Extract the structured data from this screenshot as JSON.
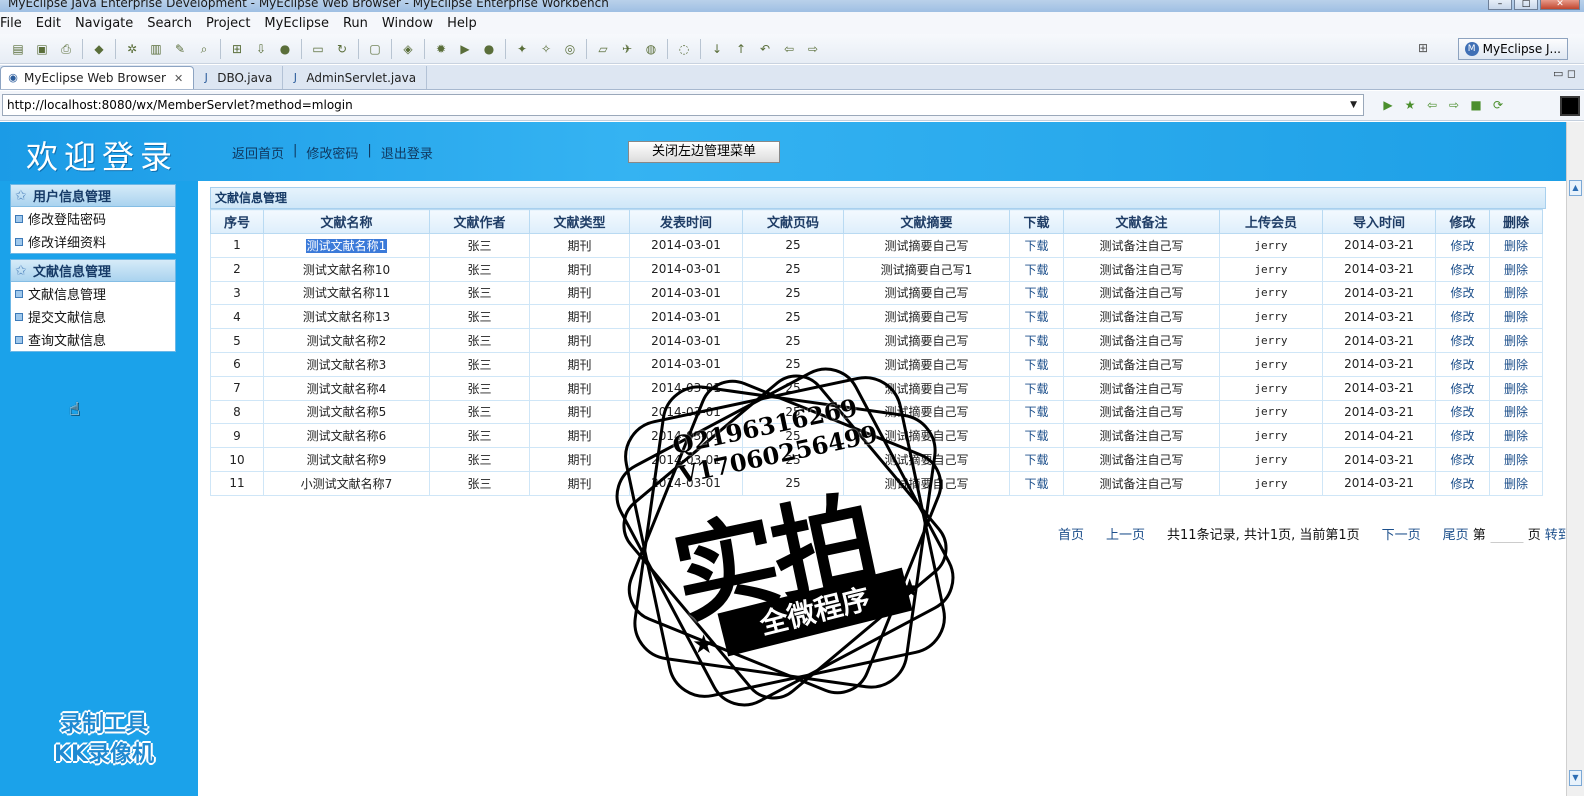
{
  "window": {
    "title": "MyEclipse Java Enterprise Development - MyEclipse Web Browser - MyEclipse Enterprise Workbench"
  },
  "menu": [
    "File",
    "Edit",
    "Navigate",
    "Search",
    "Project",
    "MyEclipse",
    "Run",
    "Window",
    "Help"
  ],
  "perspective": {
    "label": "MyEclipse J..."
  },
  "tabs": [
    {
      "label": "MyEclipse Web Browser",
      "active": true
    },
    {
      "label": "DBO.java",
      "active": false
    },
    {
      "label": "AdminServlet.java",
      "active": false
    }
  ],
  "address": {
    "url": "http://localhost:8080/wx/MemberServlet?method=mlogin"
  },
  "banner": {
    "welcome": "欢迎登录",
    "links": [
      "返回首页",
      "修改密码",
      "退出登录"
    ],
    "separator": "|",
    "close_menu_button": "关闭左边管理菜单"
  },
  "sidebar": {
    "sections": [
      {
        "title": "用户信息管理",
        "items": [
          "修改登陆密码",
          "修改详细资料"
        ]
      },
      {
        "title": "文献信息管理",
        "items": [
          "文献信息管理",
          "提交文献信息",
          "查询文献信息"
        ]
      }
    ],
    "kk_watermark": [
      "录制工具",
      "KK录像机"
    ]
  },
  "content": {
    "title": "文献信息管理",
    "columns": [
      "序号",
      "文献名称",
      "文献作者",
      "文献类型",
      "发表时间",
      "文献页码",
      "文献摘要",
      "下载",
      "文献备注",
      "上传会员",
      "导入时间",
      "修改",
      "删除"
    ],
    "rows": [
      [
        "1",
        "测试文献名称1",
        "张三",
        "期刊",
        "2014-03-01",
        "25",
        "测试摘要自己写",
        "下载",
        "测试备注自己写",
        "jerry",
        "2014-03-21",
        "修改",
        "删除"
      ],
      [
        "2",
        "测试文献名称10",
        "张三",
        "期刊",
        "2014-03-01",
        "25",
        "测试摘要自己写1",
        "下载",
        "测试备注自己写",
        "jerry",
        "2014-03-21",
        "修改",
        "删除"
      ],
      [
        "3",
        "测试文献名称11",
        "张三",
        "期刊",
        "2014-03-01",
        "25",
        "测试摘要自己写",
        "下载",
        "测试备注自己写",
        "jerry",
        "2014-03-21",
        "修改",
        "删除"
      ],
      [
        "4",
        "测试文献名称13",
        "张三",
        "期刊",
        "2014-03-01",
        "25",
        "测试摘要自己写",
        "下载",
        "测试备注自己写",
        "jerry",
        "2014-03-21",
        "修改",
        "删除"
      ],
      [
        "5",
        "测试文献名称2",
        "张三",
        "期刊",
        "2014-03-01",
        "25",
        "测试摘要自己写",
        "下载",
        "测试备注自己写",
        "jerry",
        "2014-03-21",
        "修改",
        "删除"
      ],
      [
        "6",
        "测试文献名称3",
        "张三",
        "期刊",
        "2014-03-01",
        "25",
        "测试摘要自己写",
        "下载",
        "测试备注自己写",
        "jerry",
        "2014-03-21",
        "修改",
        "删除"
      ],
      [
        "7",
        "测试文献名称4",
        "张三",
        "期刊",
        "2014-03-01",
        "25",
        "测试摘要自己写",
        "下载",
        "测试备注自己写",
        "jerry",
        "2014-03-21",
        "修改",
        "删除"
      ],
      [
        "8",
        "测试文献名称5",
        "张三",
        "期刊",
        "2014-03-01",
        "25",
        "测试摘要自己写",
        "下载",
        "测试备注自己写",
        "jerry",
        "2014-03-21",
        "修改",
        "删除"
      ],
      [
        "9",
        "测试文献名称6",
        "张三",
        "期刊",
        "2014-03-01",
        "25",
        "测试摘要自己写",
        "下载",
        "测试备注自己写",
        "jerry",
        "2014-04-21",
        "修改",
        "删除"
      ],
      [
        "10",
        "测试文献名称9",
        "张三",
        "期刊",
        "2014-03-01",
        "25",
        "测试摘要自己写",
        "下载",
        "测试备注自己写",
        "jerry",
        "2014-03-21",
        "修改",
        "删除"
      ],
      [
        "11",
        "小测试文献名称7",
        "张三",
        "期刊",
        "2014-03-01",
        "25",
        "测试摘要自己写",
        "下载",
        "测试备注自己写",
        "jerry",
        "2014-03-21",
        "修改",
        "删除"
      ]
    ],
    "highlighted_cell": "测试文献名称1"
  },
  "pager": {
    "first": "首页",
    "prev": "上一页",
    "info": "共11条记录, 共计1页, 当前第1页",
    "next": "下一页",
    "last": "尾页",
    "page_prefix": "第",
    "page_suffix": "页",
    "go": "转到"
  },
  "stamp": {
    "line1": "Q2196316269",
    "line2": "V17060256499",
    "big": "实拍",
    "ribbon": "全微程序"
  },
  "colors": {
    "banner_blue": "#1ba2ea",
    "header_text": "#1f3d66",
    "link_text": "#1c4f8b"
  }
}
